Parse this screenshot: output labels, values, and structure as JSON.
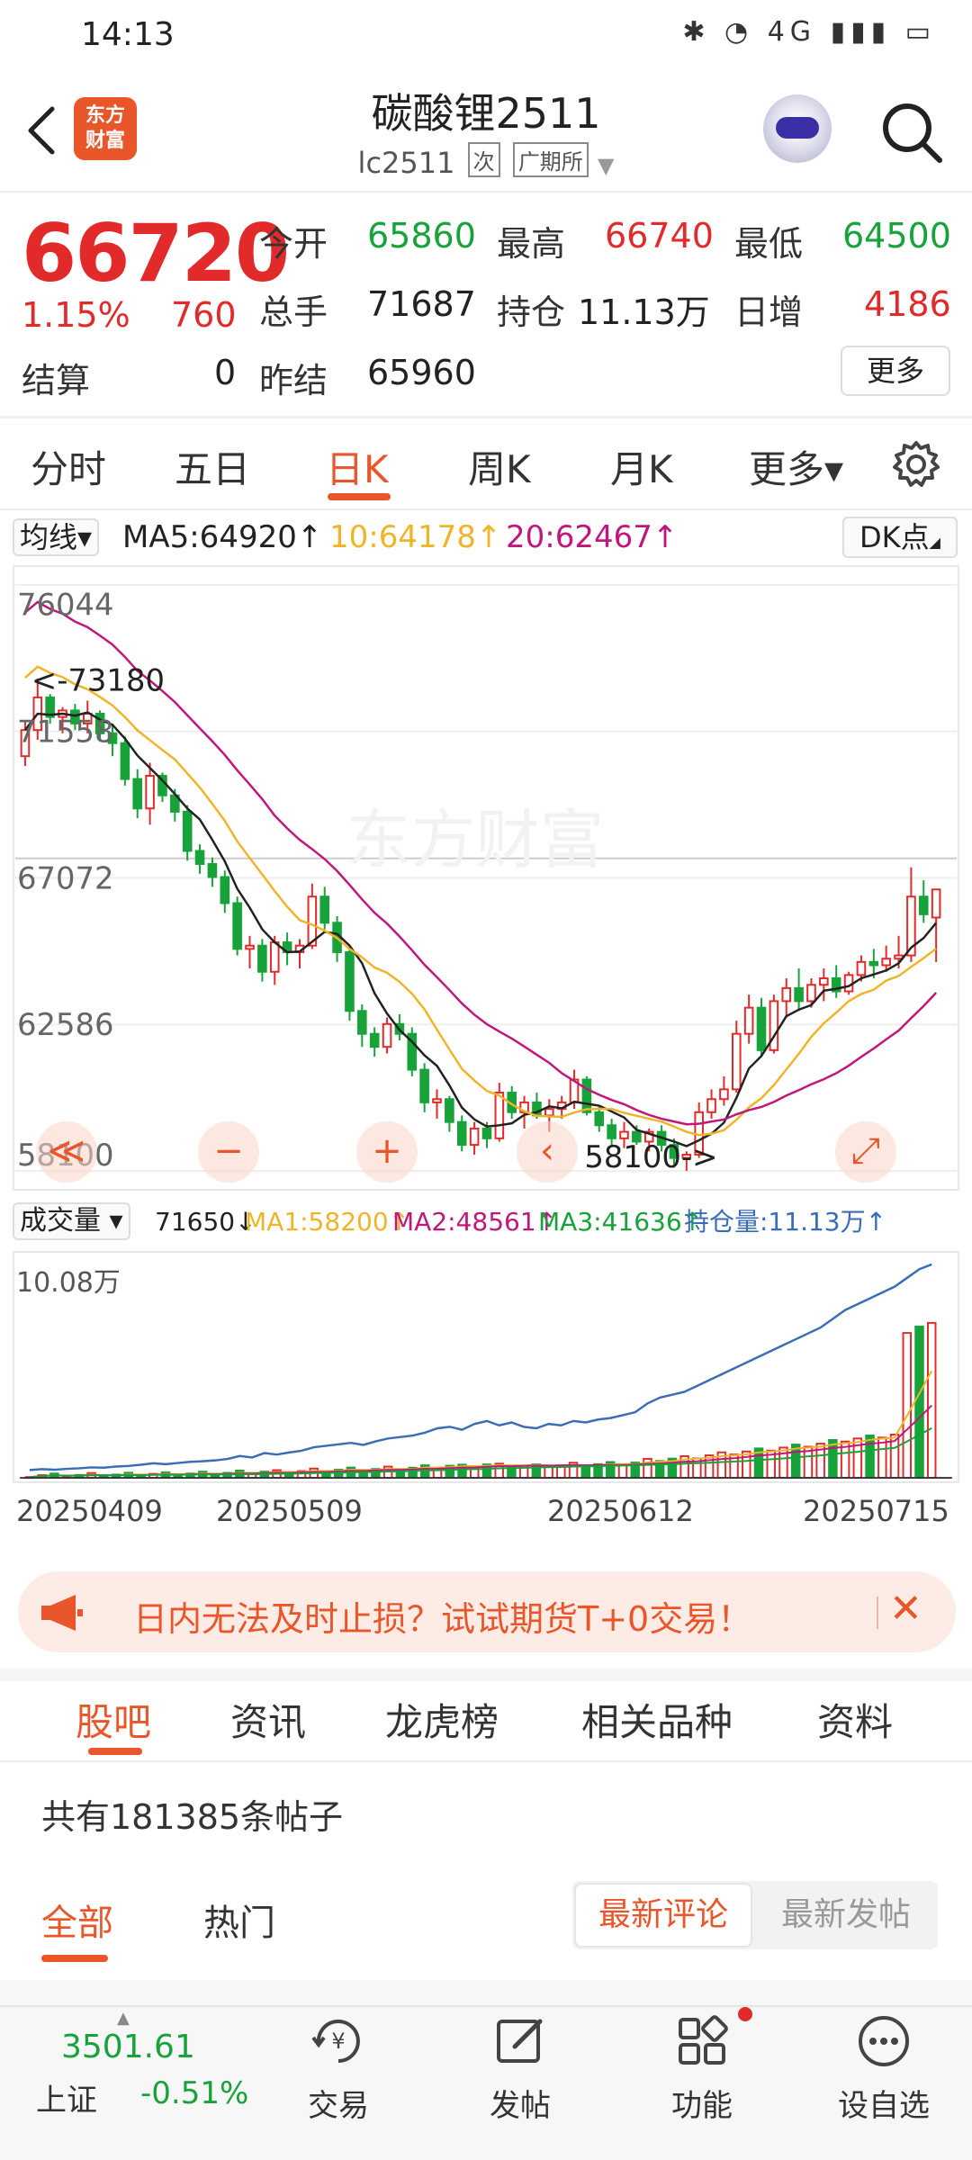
{
  "status_bar": {
    "time": "14:13",
    "icons": "✱ ◔ 4G ▮▮▮ ▭"
  },
  "header": {
    "title": "碳酸锂2511",
    "code": "lc2511",
    "tag_secondary": "次",
    "exchange": "广期所",
    "logo_line1": "东方",
    "logo_line2": "财富"
  },
  "quote": {
    "price": "66720",
    "change_pct": "1.15%",
    "change_val": "760",
    "open_label": "今开",
    "open": "65860",
    "high_label": "最高",
    "high": "66740",
    "low_label": "最低",
    "low": "64500",
    "volume_label": "总手",
    "volume": "71687",
    "oi_label": "持仓",
    "oi": "11.13万",
    "daily_inc_label": "日增",
    "daily_inc": "4186",
    "settle_label": "结算",
    "settle": "0",
    "prev_settle_label": "昨结",
    "prev_settle": "65960",
    "more_label": "更多"
  },
  "period_tabs": [
    "分时",
    "五日",
    "日K",
    "周K",
    "月K",
    "更多▾"
  ],
  "active_period": "日K",
  "ma_legend": {
    "btn": "均线▾",
    "ma5": "MA5:64920↑",
    "ma10": "10:64178↑",
    "ma20": "20:62467↑",
    "dk": "DK点"
  },
  "chart_data": {
    "type": "candlestick",
    "y_ticks": [
      "76044",
      "71558",
      "67072",
      "62586",
      "58100"
    ],
    "ylim": [
      58100,
      76044
    ],
    "high_marker": "<-73180",
    "low_marker": "58100->",
    "watermark": "东方财富",
    "x_labels": [
      "20250409",
      "20250509",
      "20250612",
      "20250715"
    ],
    "candles": [
      [
        70800,
        71900,
        70500,
        71600,
        1
      ],
      [
        71600,
        73180,
        71300,
        72600,
        1
      ],
      [
        72600,
        72700,
        71800,
        72000,
        0
      ],
      [
        72000,
        72300,
        71500,
        72200,
        1
      ],
      [
        72200,
        72400,
        71600,
        71800,
        0
      ],
      [
        71800,
        72500,
        71500,
        72100,
        1
      ],
      [
        72100,
        72200,
        71300,
        71500,
        0
      ],
      [
        71500,
        71800,
        70800,
        71200,
        0
      ],
      [
        71200,
        71400,
        69900,
        70100,
        0
      ],
      [
        70100,
        70400,
        68900,
        69200,
        0
      ],
      [
        69200,
        70600,
        68700,
        70200,
        1
      ],
      [
        70200,
        70300,
        69400,
        69600,
        0
      ],
      [
        69600,
        69800,
        68800,
        69100,
        0
      ],
      [
        69100,
        69300,
        67600,
        67900,
        0
      ],
      [
        67900,
        68100,
        67200,
        67500,
        0
      ],
      [
        67500,
        67700,
        66800,
        67100,
        0
      ],
      [
        67100,
        67300,
        66000,
        66300,
        0
      ],
      [
        66300,
        66500,
        64700,
        64900,
        0
      ],
      [
        64900,
        65300,
        64300,
        65000,
        1
      ],
      [
        65000,
        65200,
        63900,
        64200,
        0
      ],
      [
        64200,
        65300,
        63800,
        65100,
        1
      ],
      [
        65100,
        65400,
        64400,
        64800,
        0
      ],
      [
        64800,
        65200,
        64300,
        65000,
        1
      ],
      [
        65000,
        66900,
        64900,
        66500,
        1
      ],
      [
        66500,
        66800,
        65500,
        65700,
        0
      ],
      [
        65700,
        65900,
        64500,
        64800,
        0
      ],
      [
        64800,
        65000,
        62700,
        63000,
        0
      ],
      [
        63000,
        63200,
        61900,
        62300,
        0
      ],
      [
        62300,
        62500,
        61600,
        61900,
        0
      ],
      [
        61900,
        62800,
        61700,
        62600,
        1
      ],
      [
        62600,
        62900,
        62100,
        62300,
        0
      ],
      [
        62300,
        62500,
        61000,
        61200,
        0
      ],
      [
        61200,
        61400,
        59900,
        60200,
        0
      ],
      [
        60200,
        60600,
        59700,
        60300,
        1
      ],
      [
        60300,
        60400,
        59300,
        59600,
        0
      ],
      [
        59600,
        59800,
        58700,
        58900,
        0
      ],
      [
        58900,
        59600,
        58600,
        59400,
        1
      ],
      [
        59400,
        59600,
        58800,
        59100,
        0
      ],
      [
        59100,
        60800,
        59000,
        60500,
        1
      ],
      [
        60500,
        60700,
        59700,
        59900,
        0
      ],
      [
        59900,
        60400,
        59400,
        60200,
        1
      ],
      [
        60200,
        60500,
        59700,
        59800,
        0
      ],
      [
        59800,
        60300,
        59300,
        60000,
        1
      ],
      [
        60000,
        60400,
        59700,
        60200,
        1
      ],
      [
        60200,
        61200,
        60000,
        60900,
        1
      ],
      [
        60900,
        61000,
        59800,
        59900,
        0
      ],
      [
        59900,
        60100,
        59300,
        59500,
        0
      ],
      [
        59500,
        59700,
        58900,
        59100,
        0
      ],
      [
        59100,
        59600,
        58800,
        59300,
        1
      ],
      [
        59300,
        59500,
        58900,
        59000,
        0
      ],
      [
        59000,
        59400,
        58700,
        59300,
        1
      ],
      [
        59300,
        59500,
        58700,
        58900,
        0
      ],
      [
        58900,
        59100,
        58200,
        58500,
        0
      ],
      [
        58500,
        58700,
        58100,
        58600,
        1
      ],
      [
        58600,
        60200,
        58500,
        59900,
        1
      ],
      [
        59900,
        60600,
        59700,
        60300,
        1
      ],
      [
        60300,
        61000,
        60100,
        60600,
        1
      ],
      [
        60600,
        62700,
        60500,
        62300,
        1
      ],
      [
        62300,
        63500,
        62000,
        63100,
        1
      ],
      [
        63100,
        63400,
        61600,
        61800,
        0
      ],
      [
        61800,
        63500,
        61700,
        63300,
        1
      ],
      [
        63300,
        64000,
        62800,
        63700,
        1
      ],
      [
        63700,
        64300,
        63000,
        63300,
        0
      ],
      [
        63300,
        64000,
        63100,
        63800,
        1
      ],
      [
        63800,
        64300,
        63300,
        64000,
        1
      ],
      [
        64000,
        64400,
        63400,
        63600,
        0
      ],
      [
        63600,
        64200,
        63500,
        64100,
        1
      ],
      [
        64100,
        64700,
        63900,
        64500,
        1
      ],
      [
        64500,
        64900,
        64000,
        64400,
        0
      ],
      [
        64400,
        65000,
        64200,
        64600,
        1
      ],
      [
        64600,
        65300,
        64300,
        64700,
        1
      ],
      [
        64700,
        67400,
        64500,
        66500,
        1
      ],
      [
        66500,
        67000,
        65700,
        65960,
        0
      ],
      [
        65860,
        66740,
        64500,
        66720,
        1
      ]
    ],
    "ma_colors": {
      "ma5": "#222222",
      "ma10": "#f0b429",
      "ma20": "#c0187a"
    }
  },
  "volume_legend": {
    "btn": "成交量 ▾",
    "vol": "71650↓",
    "ma1": "MA1:58200↑",
    "ma2": "MA2:48561↑",
    "ma3": "MA3:41636↑",
    "oi": "持仓量:11.13万↑",
    "y_top": "10.08万"
  },
  "volume_data": {
    "ymax": 100800,
    "volumes": [
      1200,
      1500,
      1300,
      1600,
      1800,
      2100,
      2000,
      2400,
      2600,
      3000,
      3500,
      3200,
      3600,
      4000,
      4200,
      4500,
      5000,
      6000,
      5500,
      7000,
      6500,
      7200,
      7800,
      9000,
      9500,
      10000,
      10500,
      9800,
      11000,
      12000,
      12500,
      13000,
      14000,
      15500,
      16000,
      15000,
      17000,
      18000,
      16500,
      17500,
      16000,
      15500,
      17000,
      16500,
      18000,
      17500,
      18500,
      19000,
      20000,
      21000,
      24000,
      26000,
      27000,
      28000,
      30000,
      32000,
      34000,
      36000,
      38000,
      40000,
      42000,
      44000,
      46000,
      48000,
      50000,
      53000,
      56000,
      58000,
      60000,
      62000,
      64000,
      67000,
      70000,
      71650
    ],
    "real_volumes": [
      null,
      null,
      null,
      null,
      null,
      null,
      null,
      null,
      null,
      null,
      null,
      null,
      null,
      null,
      null,
      null,
      null,
      null,
      null,
      null,
      null,
      null,
      null,
      null,
      null,
      null,
      null,
      null,
      null,
      null,
      null,
      null,
      null,
      null,
      null,
      null,
      null,
      null,
      null,
      null,
      null,
      null,
      null,
      null,
      null,
      null,
      null,
      null,
      null,
      null,
      null,
      null,
      null,
      null,
      null,
      null,
      null,
      null,
      null,
      null,
      null,
      null,
      null,
      null,
      null,
      null,
      null,
      null,
      null,
      null,
      null,
      null,
      null,
      null
    ]
  },
  "controls": {
    "rewind": "≪",
    "zoom_out": "−",
    "zoom_in": "+",
    "prev": "‹",
    "expand": "⤢"
  },
  "banner": {
    "text": "日内无法及时止损？试试期货T+0交易！",
    "close": "✕"
  },
  "bottom_tabs": [
    "股吧",
    "资讯",
    "龙虎榜",
    "相关品种",
    "资料"
  ],
  "forum": {
    "count": "共有181385条帖子",
    "filters": [
      "全部",
      "热门"
    ],
    "sort_latest_comment": "最新评论",
    "sort_latest_post": "最新发帖"
  },
  "bottom_nav": {
    "index_value": "3501.61",
    "index_name": "上证",
    "index_change": "-0.51%",
    "items": [
      "交易",
      "发帖",
      "功能",
      "设自选"
    ]
  }
}
